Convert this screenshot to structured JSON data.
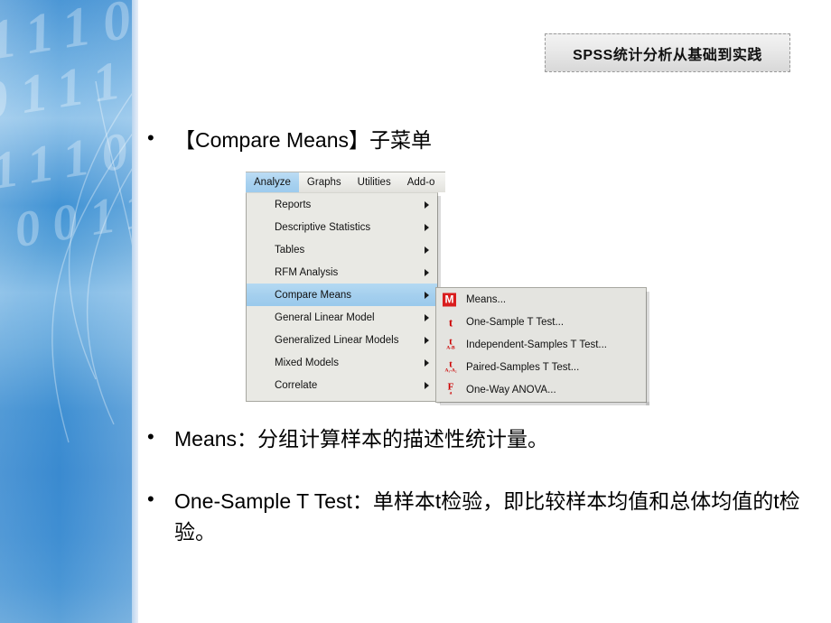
{
  "header": {
    "title": "SPSS统计分析从基础到实践"
  },
  "bullets": [
    {
      "marker": "•",
      "text": "【Compare Means】子菜单"
    },
    {
      "marker": "•",
      "text": "Means：分组计算样本的描述性统计量。"
    },
    {
      "marker": "•",
      "text": "One-Sample T Test：单样本t检验，即比较样本均值和总体均值的t检验。"
    }
  ],
  "spss": {
    "menubar": [
      {
        "label": "Analyze",
        "mnemonic": "A",
        "active": true
      },
      {
        "label": "Graphs",
        "mnemonic": "G",
        "active": false
      },
      {
        "label": "Utilities",
        "mnemonic": "U",
        "active": false
      },
      {
        "label": "Add-o",
        "mnemonic": "",
        "active": false
      }
    ],
    "dropdown": [
      {
        "label": "Reports",
        "selected": false,
        "arrow": true
      },
      {
        "label": "Descriptive Statistics",
        "selected": false,
        "arrow": true
      },
      {
        "label": "Tables",
        "selected": false,
        "arrow": true
      },
      {
        "label": "RFM Analysis",
        "selected": false,
        "arrow": true
      },
      {
        "label": "Compare Means",
        "selected": true,
        "arrow": true
      },
      {
        "label": "General Linear Model",
        "selected": false,
        "arrow": true
      },
      {
        "label": "Generalized Linear Models",
        "selected": false,
        "arrow": true
      },
      {
        "label": "Mixed Models",
        "selected": false,
        "arrow": true
      },
      {
        "label": "Correlate",
        "selected": false,
        "arrow": true
      }
    ],
    "submenu": [
      {
        "label": "Means...",
        "icon": "means-icon",
        "glyph": "M"
      },
      {
        "label": "One-Sample T Test...",
        "icon": "one-sample-t-test-icon",
        "glyph": "t"
      },
      {
        "label": "Independent-Samples T Test...",
        "icon": "independent-samples-t-test-icon",
        "glyph": "t",
        "sub": "A-B"
      },
      {
        "label": "Paired-Samples T Test...",
        "icon": "paired-samples-t-test-icon",
        "glyph": "t",
        "sub": "A₁-A₂"
      },
      {
        "label": "One-Way ANOVA...",
        "icon": "one-way-anova-icon",
        "glyph": "F",
        "sub": "a"
      }
    ]
  },
  "colors": {
    "sidebar_blue": "#3f8ed2",
    "menu_highlight": "#a4cfee",
    "icon_red": "#cc0000",
    "menu_bg": "#e9e9e4"
  }
}
